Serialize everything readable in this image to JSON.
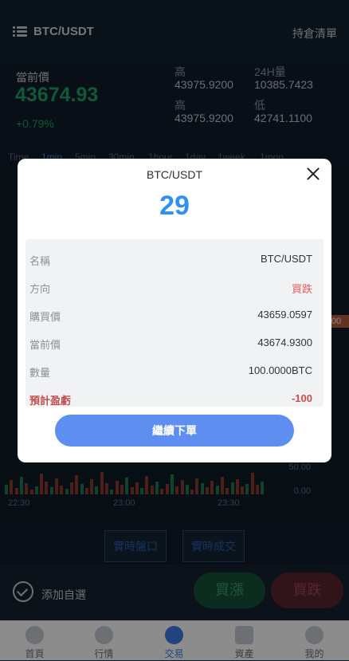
{
  "header": {
    "pair": "BTC/USDT",
    "positions": "持倉清單"
  },
  "stats": {
    "current_label": "當前價",
    "current_price": "43674.93",
    "change": "+0.79%",
    "high_label_1": "高",
    "high_value_1": "43975.9200",
    "vol_label": "24H量",
    "vol_value": "10385.7423",
    "high_label_2": "高",
    "high_value_2": "43975.9200",
    "low_label": "低",
    "low_value": "42741.1100"
  },
  "intervals": [
    "Time",
    "1min",
    "5min",
    "30min",
    "1hour",
    "1day",
    "1week",
    "1mon"
  ],
  "chart": {
    "x_ticks": [
      "22:30",
      "23:00",
      "23:30"
    ],
    "y_ticks": [
      "50.00",
      "0.00"
    ],
    "price_tag": "00"
  },
  "actions": {
    "realtime_book": "實時盤口",
    "realtime_trades": "實時成交"
  },
  "trade": {
    "watch": "添加自選",
    "buy": "買漲",
    "sell": "買跌"
  },
  "tabs": [
    {
      "label": "首頁"
    },
    {
      "label": "行情"
    },
    {
      "label": "交易"
    },
    {
      "label": "資產"
    },
    {
      "label": "我的"
    }
  ],
  "modal": {
    "title": "BTC/USDT",
    "countdown": "29",
    "rows": [
      {
        "key": "名稱",
        "value": "BTC/USDT"
      },
      {
        "key": "方向",
        "value": "買跌"
      },
      {
        "key": "購買價",
        "value": "43659.0597"
      },
      {
        "key": "當前價",
        "value": "43674.9300"
      },
      {
        "key": "數量",
        "value": "100.0000BTC"
      },
      {
        "key": "預計盈虧",
        "value": "-100"
      }
    ],
    "continue": "繼續下單"
  },
  "colors": {
    "up": "#1fa363",
    "down": "#e05e5e",
    "accent": "#2f8ff5",
    "button": "#5d8ef0"
  }
}
